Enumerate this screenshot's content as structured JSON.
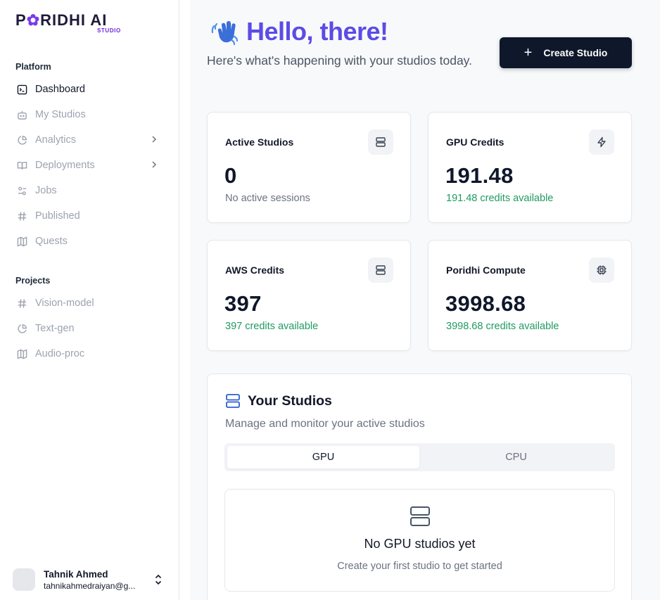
{
  "brand": {
    "logo_text_1": "P",
    "logo_text_2": "RIDHI AI",
    "logo_sub": "STUDIO"
  },
  "sidebar": {
    "platform_label": "Platform",
    "platform_items": [
      {
        "label": "Dashboard",
        "icon": "terminal-square-icon",
        "active": true
      },
      {
        "label": "My Studios",
        "icon": "bot-icon"
      },
      {
        "label": "Analytics",
        "icon": "pie-chart-icon",
        "has_chevron": true
      },
      {
        "label": "Deployments",
        "icon": "book-open-icon",
        "has_chevron": true
      },
      {
        "label": "Jobs",
        "icon": "settings-sliders-icon"
      },
      {
        "label": "Published",
        "icon": "hash-icon"
      },
      {
        "label": "Quests",
        "icon": "map-icon"
      }
    ],
    "projects_label": "Projects",
    "project_items": [
      {
        "label": "Vision-model",
        "icon": "hash-icon"
      },
      {
        "label": "Text-gen",
        "icon": "pie-chart-icon"
      },
      {
        "label": "Audio-proc",
        "icon": "map-icon"
      }
    ]
  },
  "user": {
    "name": "Tahnik Ahmed",
    "email": "tahnikahmedraiyan@g..."
  },
  "header": {
    "greeting": "Hello, there!",
    "subtitle": "Here's what's happening with your studios today.",
    "create_button": "Create Studio"
  },
  "cards": [
    {
      "title": "Active Studios",
      "value": "0",
      "sub": "No active sessions",
      "icon": "server-icon"
    },
    {
      "title": "GPU Credits",
      "value": "191.48",
      "sub": "191.48 credits available",
      "icon": "zap-icon"
    },
    {
      "title": "AWS Credits",
      "value": "397",
      "sub": "397 credits available",
      "icon": "server-icon"
    },
    {
      "title": "Poridhi Compute",
      "value": "3998.68",
      "sub": "3998.68 credits available",
      "icon": "cpu-icon"
    }
  ],
  "studios": {
    "title": "Your Studios",
    "subtitle": "Manage and monitor your active studios",
    "tabs": [
      "GPU",
      "CPU"
    ],
    "empty_title": "No GPU studios yet",
    "empty_sub": "Create your first studio to get started"
  },
  "colors": {
    "accent": "#5b4ce6",
    "brand_purple": "#7c3aed",
    "positive": "#1f9b63",
    "primary_button": "#0f172a"
  }
}
